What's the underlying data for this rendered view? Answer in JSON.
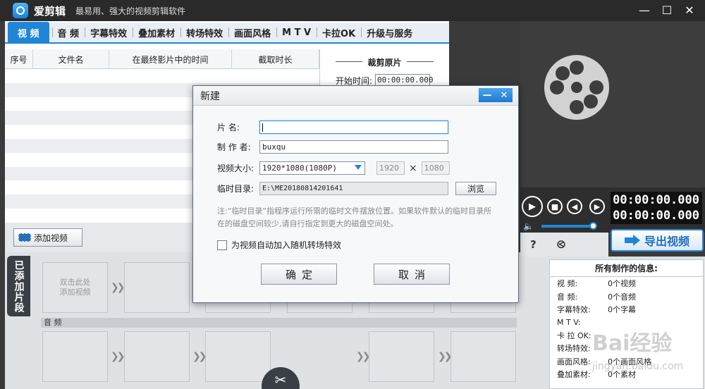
{
  "app": {
    "name": "爱剪辑",
    "slogan": "最易用、强大的视频剪辑软件",
    "window_controls": [
      "—",
      "☐",
      "✕"
    ]
  },
  "tabs": [
    {
      "label": "视 频",
      "active": true
    },
    {
      "label": "音 频"
    },
    {
      "label": "字幕特效"
    },
    {
      "label": "叠加素材"
    },
    {
      "label": "转场特效"
    },
    {
      "label": "画面风格"
    },
    {
      "label": "M T V"
    },
    {
      "label": "卡拉OK"
    },
    {
      "label": "升级与服务"
    }
  ],
  "table": {
    "columns": [
      "序号",
      "文件名",
      "在最终影片中的时间",
      "截取时长"
    ]
  },
  "crop": {
    "title": "裁剪原片",
    "start_label": "开始时间:",
    "start_value": "00:00:00.000"
  },
  "add_video_label": "添加视频",
  "timeline": {
    "side_label": "已添加片段",
    "first_clip_text": "双击此处\n添加视频",
    "audio_label": "音 频"
  },
  "player": {
    "timecode_current": "00:00:00.000",
    "timecode_total": "00:00:00.000",
    "volume": 0.85
  },
  "export_label": "导出视频",
  "info": {
    "title": "所有制作的信息:",
    "rows": [
      {
        "label": "视    频:",
        "value": "0个视频"
      },
      {
        "label": "音    频:",
        "value": "0个音频"
      },
      {
        "label": "字幕特效:",
        "value": "0个字幕"
      },
      {
        "label": "M  T  V:",
        "value": ""
      },
      {
        "label": "卡 拉 OK:",
        "value": ""
      },
      {
        "label": "转场特效:",
        "value": ""
      },
      {
        "label": "画面风格:",
        "value": "0个画面风格"
      },
      {
        "label": "叠加素材:",
        "value": "0个素材"
      }
    ]
  },
  "watermark": {
    "text": "Bai经验",
    "sub": "jingyan.baidu.com"
  },
  "dialog": {
    "title": "新建",
    "name_label": "片    名:",
    "name_value": "",
    "author_label": "制 作 者:",
    "author_value": "buxqu",
    "size_label": "视频大小:",
    "size_value": "1920*1080(1080P)",
    "width_value": "1920",
    "height_value": "1080",
    "dim_separator": "×",
    "temp_label": "临时目录:",
    "temp_value": "E:\\ME20180814201641",
    "browse_label": "浏览",
    "note": "注:“临时目录”指程序运行所需的临时文件摆放位置。如果软件默认的临时目录所在的磁盘空间较少,请自行指定到更大的磁盘空间处。",
    "checkbox_label": "为视频自动加入随机转场特效",
    "ok_label": "确定",
    "cancel_label": "取消"
  }
}
